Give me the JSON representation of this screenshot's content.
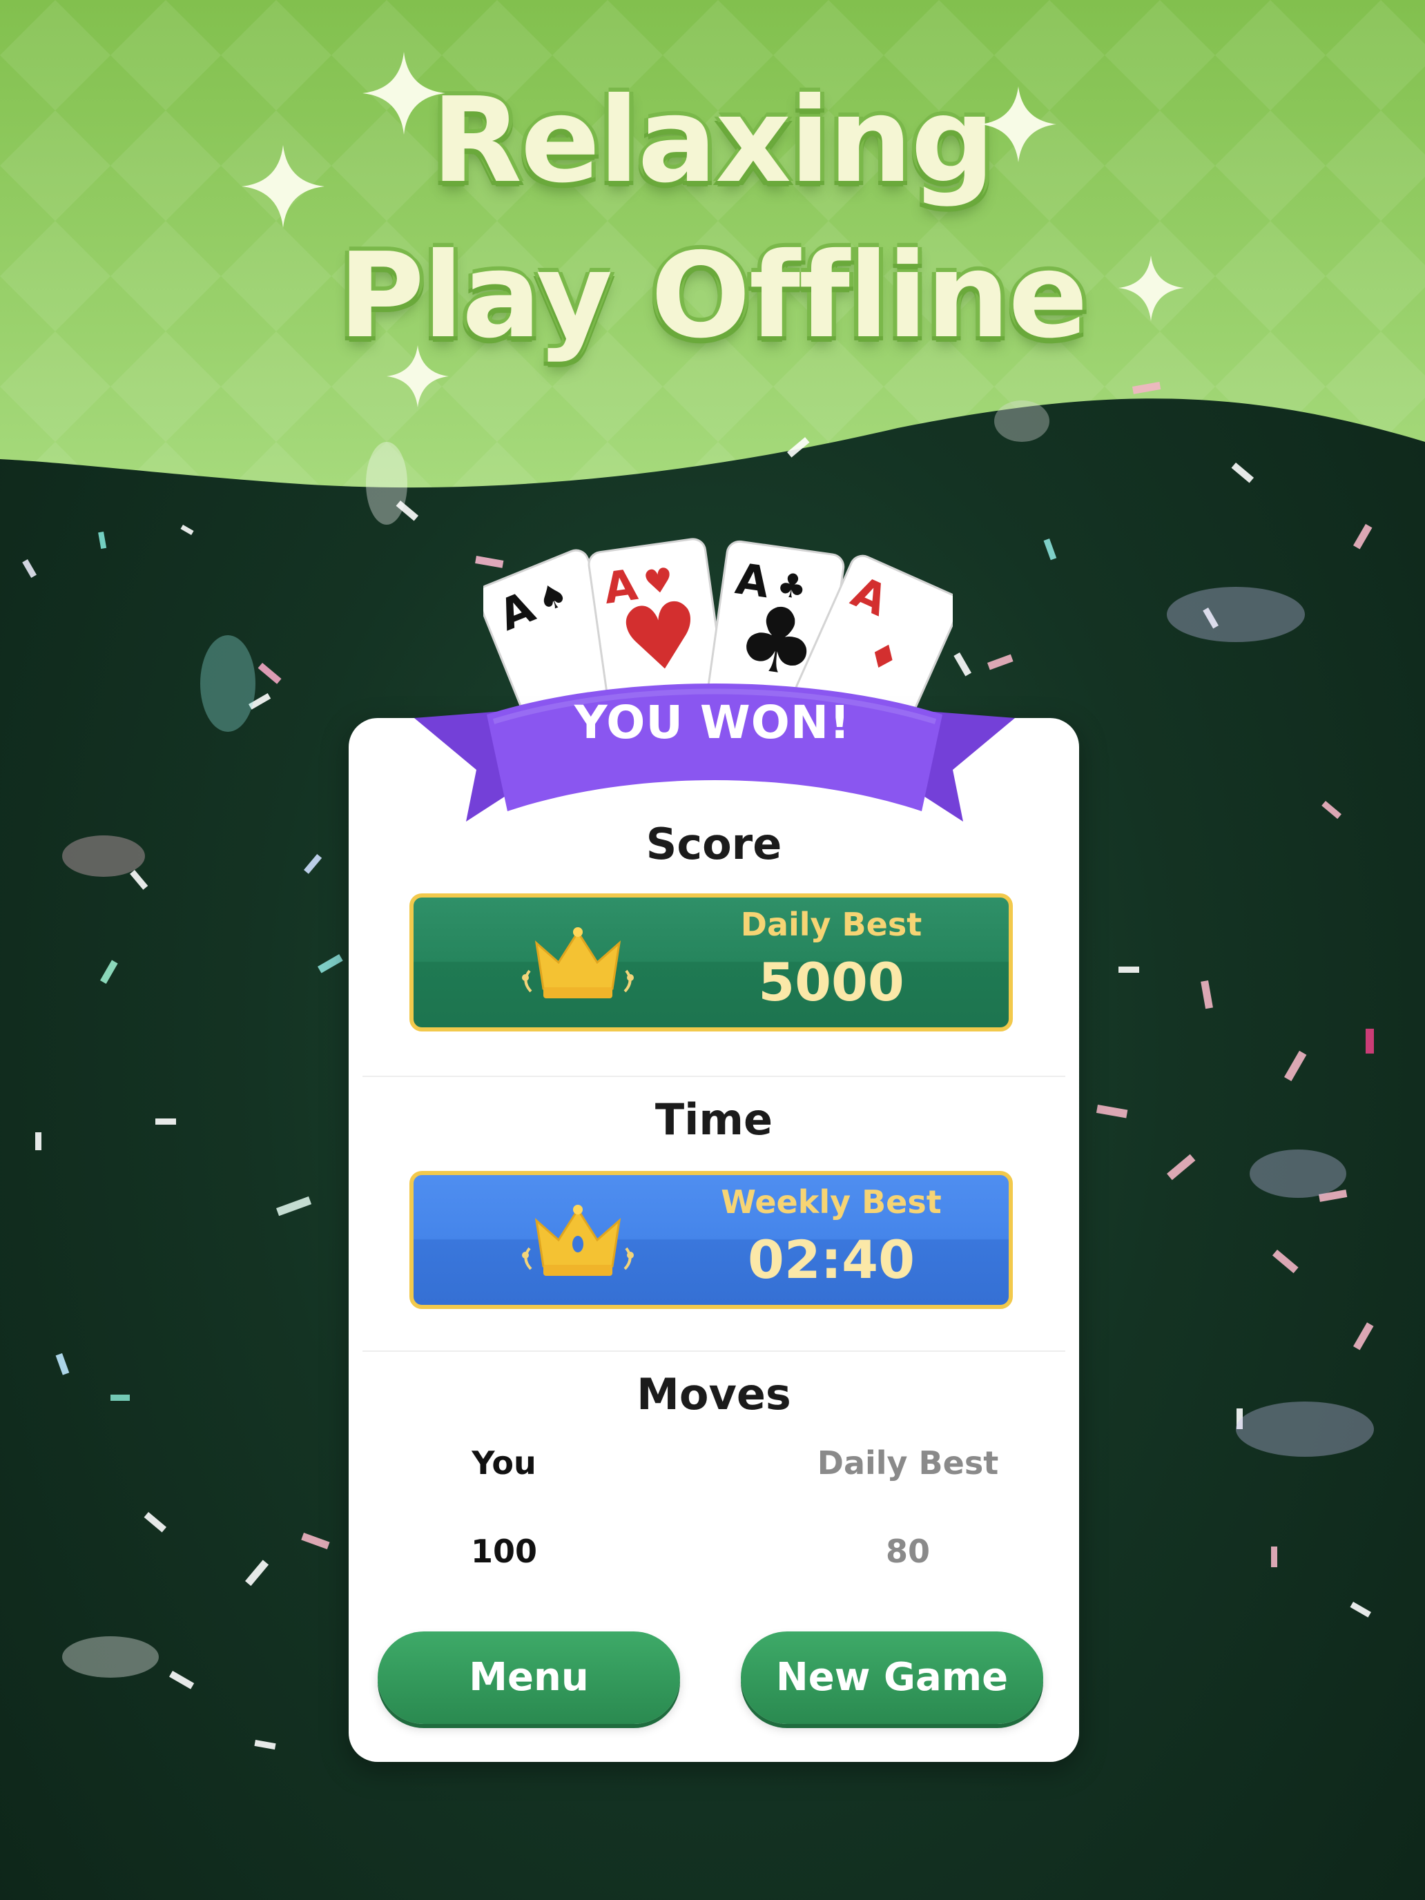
{
  "header": {
    "line1": "Relaxing",
    "line2": "Play Offline"
  },
  "colors": {
    "header_green": "#8bc75a",
    "felt_green": "#143323",
    "ribbon_purple": "#8a56f0",
    "score_box": "#26855d",
    "time_box": "#4585ea",
    "button_green": "#34a05e",
    "gold_border": "#f2c94c"
  },
  "win_dialog": {
    "banner": "YOU WON!",
    "score": {
      "title": "Score",
      "best_label": "Daily Best",
      "best_value": "5000",
      "icon": "crown-icon"
    },
    "time": {
      "title": "Time",
      "best_label": "Weekly Best",
      "best_value": "02:40",
      "icon": "crown-icon"
    },
    "moves": {
      "title": "Moves",
      "you_label": "You",
      "you_value": "100",
      "best_label": "Daily Best",
      "best_value": "80"
    },
    "buttons": {
      "menu": "Menu",
      "new_game": "New Game"
    }
  },
  "cards": [
    "A♠",
    "A♥",
    "A♣",
    "A♦"
  ]
}
